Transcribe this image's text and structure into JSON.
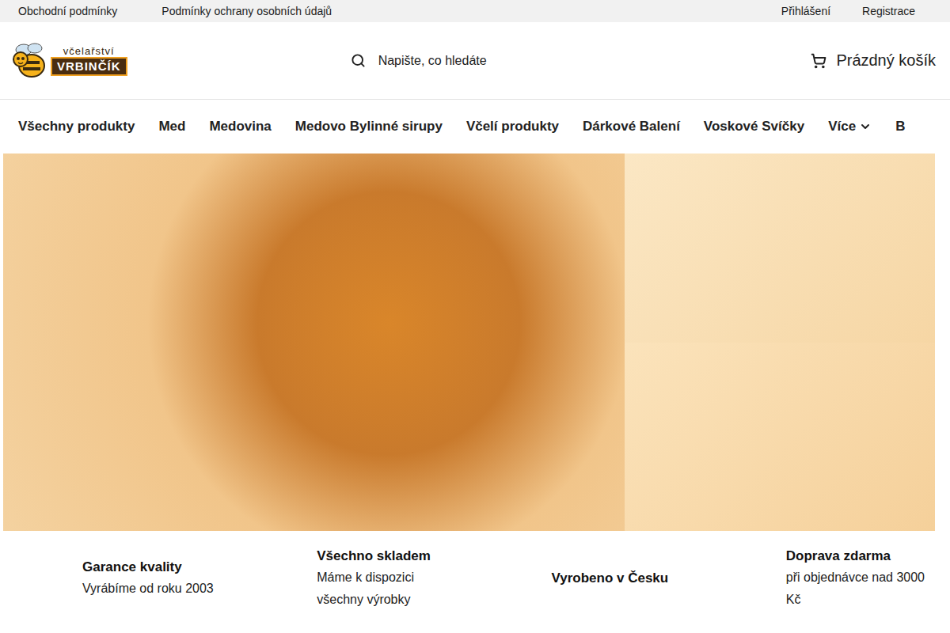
{
  "top_bar": {
    "links": [
      "Obchodní podmínky",
      "Podmínky ochrany osobních údajů"
    ],
    "account": [
      "Přihlášení",
      "Registrace"
    ]
  },
  "logo": {
    "tagline": "včelařství",
    "name": "VRBINČÍK"
  },
  "search": {
    "placeholder": "Napište, co hledáte"
  },
  "cart": {
    "label": "Prázdný košík"
  },
  "nav": {
    "items": [
      "Všechny produkty",
      "Med",
      "Medovina",
      "Medovo Bylinné sirupy",
      "Včelí produkty",
      "Dárkové Balení",
      "Voskové Svíčky"
    ],
    "more": "Více",
    "cut_item": "B"
  },
  "features": [
    {
      "title": "Garance kvality",
      "text": "Vyrábíme od roku 2003"
    },
    {
      "title": "Všechno skladem",
      "text": "Máme k dispozici všechny výrobky"
    },
    {
      "title": "Vyrobeno v Česku"
    },
    {
      "title": "Doprava zdarma",
      "text": "při objednávce nad 3000 Kč"
    }
  ]
}
